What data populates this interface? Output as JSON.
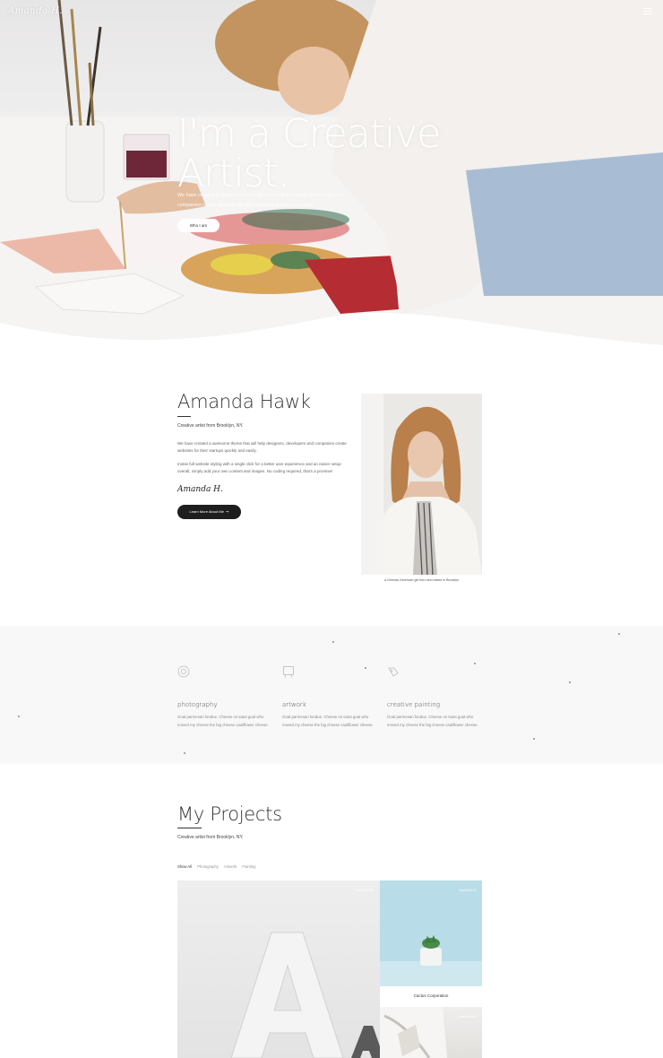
{
  "nav": {
    "logo": "Amanda H.",
    "menu_icon": "hamburger-icon"
  },
  "hero": {
    "title": "I'm a Creative Artist.",
    "description": "We have created a awesome theme that will help designers, developers and companies create websites for their startups quickly and easily.",
    "cta_label": "Who I am"
  },
  "about": {
    "name": "Amanda Hawk",
    "subtitle": "Creative artist from Brooklyn, NY.",
    "paragraph1": "We have created a awesome theme that will help designers, developers and companies create websites for their startups quickly and easily.",
    "paragraph2": "Instas full website styling with a single click for a better user experience and an easier setup overall, simply add your own content and images. No coding required, that's a promise!",
    "signature": "Amanda H.",
    "button_label": "Learn More About Me",
    "button_icon": "arrow-right-icon",
    "photo_caption": "A German-American girl born and raised in Brooklyn"
  },
  "services": [
    {
      "icon": "camera-icon",
      "title": "photography",
      "text": "Goat parmesan fondue. Cheese on toast goat who moved my cheese the big cheese cauliflower cheese."
    },
    {
      "icon": "easel-icon",
      "title": "artwork",
      "text": "Goat parmesan fondue. Cheese on toast goat who moved my cheese the big cheese cauliflower cheese."
    },
    {
      "icon": "brush-icon",
      "title": "creative painting",
      "text": "Goat parmesan fondue. Cheese on toast goat who moved my cheese the big cheese cauliflower cheese."
    }
  ],
  "projects": {
    "title": "My Projects",
    "subtitle": "Creative artist from Brooklyn, NY.",
    "filters": [
      "Show All",
      "Photography",
      "Artwork",
      "Painting"
    ],
    "active_filter": "Show All",
    "tiles": [
      {
        "label": "",
        "signature": "Amanda H."
      },
      {
        "label": "Cactus Corporation",
        "signature": "Amanda H."
      },
      {
        "label": "",
        "signature": "Amanda H."
      }
    ]
  }
}
